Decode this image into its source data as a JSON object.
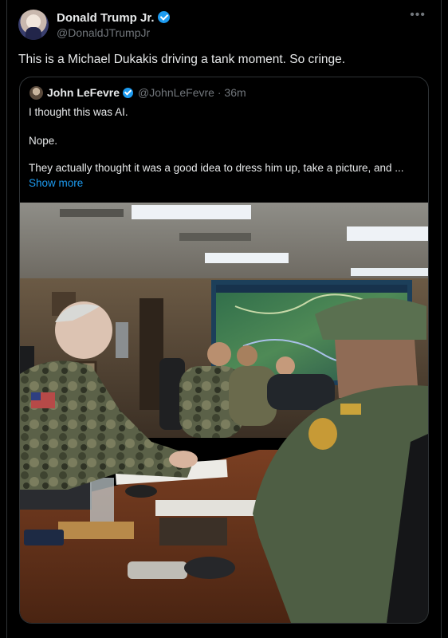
{
  "author": {
    "name": "Donald Trump Jr.",
    "handle": "@DonaldJTrumpJr"
  },
  "more_icon": "•••",
  "tweet_text": "This is a Michael Dukakis driving a tank moment. So cringe.",
  "quoted": {
    "name": "John LeFevre",
    "handle_time": "@JohnLeFevre · 36m",
    "line1": "I thought this was AI.",
    "line2": "Nope.",
    "line3": "They actually thought it was a good idea to dress him up, take a picture, and ...",
    "show_more": "Show more"
  },
  "colors": {
    "background": "#000000",
    "link": "#1d9bf0",
    "verified": "#1d9bf0",
    "muted": "#71767b"
  }
}
